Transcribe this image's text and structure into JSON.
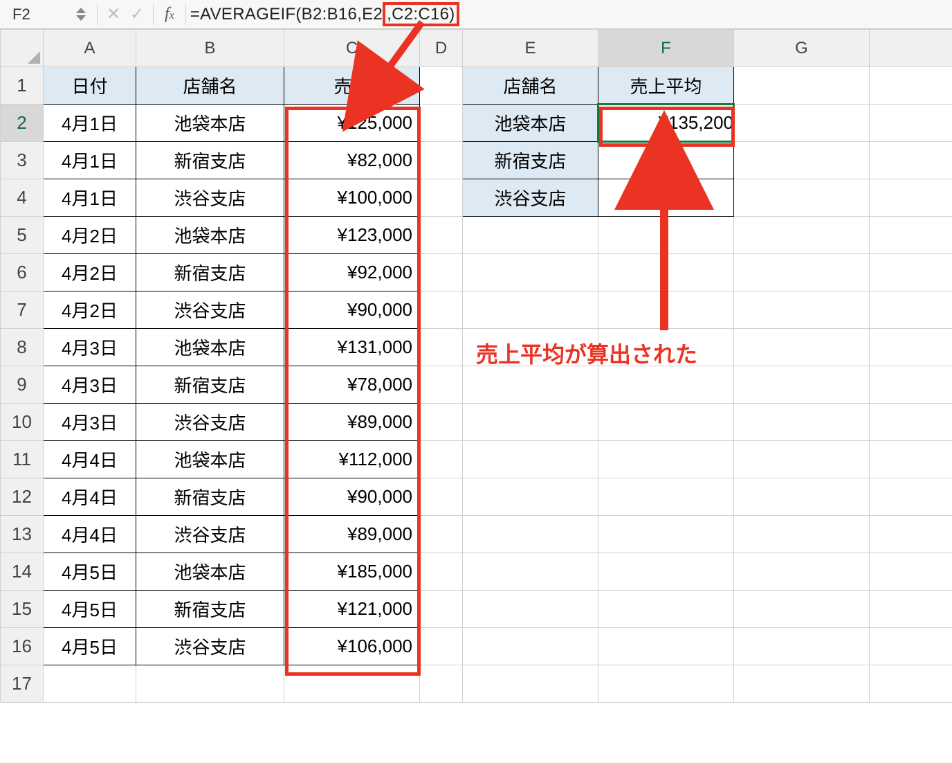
{
  "nameBox": "F2",
  "formula": {
    "prefix": "=AVERAGEIF(B2:B16,E2",
    "highlight": ",C2:C16)"
  },
  "columns": [
    "A",
    "B",
    "C",
    "D",
    "E",
    "F",
    "G"
  ],
  "headers": {
    "A": "日付",
    "B": "店舗名",
    "C": "売上",
    "E": "店舗名",
    "F": "売上平均"
  },
  "rows": [
    {
      "A": "4月1日",
      "B": "池袋本店",
      "C": "¥125,000"
    },
    {
      "A": "4月1日",
      "B": "新宿支店",
      "C": "¥82,000"
    },
    {
      "A": "4月1日",
      "B": "渋谷支店",
      "C": "¥100,000"
    },
    {
      "A": "4月2日",
      "B": "池袋本店",
      "C": "¥123,000"
    },
    {
      "A": "4月2日",
      "B": "新宿支店",
      "C": "¥92,000"
    },
    {
      "A": "4月2日",
      "B": "渋谷支店",
      "C": "¥90,000"
    },
    {
      "A": "4月3日",
      "B": "池袋本店",
      "C": "¥131,000"
    },
    {
      "A": "4月3日",
      "B": "新宿支店",
      "C": "¥78,000"
    },
    {
      "A": "4月3日",
      "B": "渋谷支店",
      "C": "¥89,000"
    },
    {
      "A": "4月4日",
      "B": "池袋本店",
      "C": "¥112,000"
    },
    {
      "A": "4月4日",
      "B": "新宿支店",
      "C": "¥90,000"
    },
    {
      "A": "4月4日",
      "B": "渋谷支店",
      "C": "¥89,000"
    },
    {
      "A": "4月5日",
      "B": "池袋本店",
      "C": "¥185,000"
    },
    {
      "A": "4月5日",
      "B": "新宿支店",
      "C": "¥121,000"
    },
    {
      "A": "4月5日",
      "B": "渋谷支店",
      "C": "¥106,000"
    }
  ],
  "eColumn": [
    "池袋本店",
    "新宿支店",
    "渋谷支店"
  ],
  "fValue": "¥135,200",
  "annotation": "売上平均が算出された"
}
